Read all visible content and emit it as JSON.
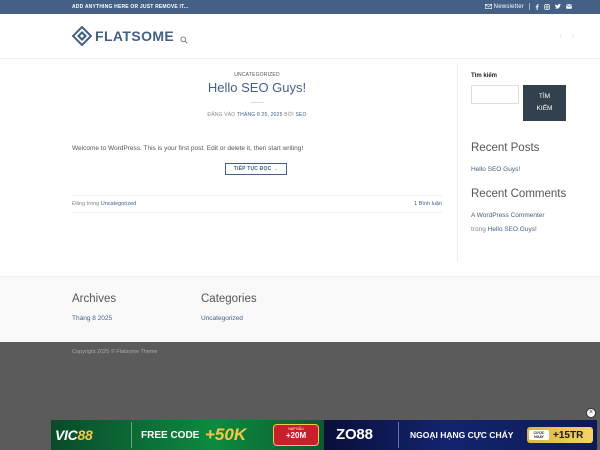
{
  "colors": {
    "primary": "#446084",
    "dark_button": "#33404d",
    "footer_bg": "#5b5b5b"
  },
  "topbar": {
    "promo": "ADD ANYTHING HERE OR JUST REMOVE IT...",
    "newsletter": "Newsletter",
    "icons": [
      "envelope-icon",
      "facebook-icon",
      "instagram-icon",
      "twitter-icon",
      "email-icon"
    ]
  },
  "header": {
    "logo_text": "FLATSOME",
    "nav_prev": "‹",
    "nav_next": "›"
  },
  "post": {
    "category": "UNCATEGORIZED",
    "title": "Hello SEO Guys!",
    "meta_prefix": "ĐĂNG VÀO",
    "meta_date": "THÁNG 8 25, 2025",
    "meta_by": "BỞI",
    "meta_author": "SEO",
    "excerpt": "Welcome to WordPress. This is your first post. Edit or delete it, then start writing!",
    "read_more": "TIẾP TỤC ĐỌC →",
    "footer_prefix": "Đăng trong",
    "footer_category": "Uncategorized",
    "footer_comments": "1 Bình luận"
  },
  "sidebar": {
    "search_label": "Tìm kiếm",
    "search_placeholder": "",
    "search_button_line1": "TÌM",
    "search_button_line2": "KIẾM",
    "recent_posts_title": "Recent Posts",
    "recent_posts": [
      "Hello SEO Guys!"
    ],
    "recent_comments_title": "Recent Comments",
    "comment_author": "A WordPress Commenter",
    "comment_on": "trong",
    "comment_post": "Hello SEO Guys!"
  },
  "footer_widgets": {
    "archives_title": "Archives",
    "archives": [
      "Tháng 8 2025"
    ],
    "categories_title": "Categories",
    "categories": [
      "Uncategorized"
    ]
  },
  "footer": {
    "copyright": "Copyright 2025 © Flatsome Theme"
  },
  "ad": {
    "close": "×",
    "brand1_a": "VIC",
    "brand1_b": "88",
    "free_code": "FREE CODE",
    "bonus": "+50K",
    "badge_small": "NẠP ĐẦU",
    "badge_big": "+20M",
    "brand2": "ZO88",
    "slogan": "NGOẠI HẠNG CỰC CHÁY",
    "cuoc_small": "CƯỢC NGAY",
    "cuoc_big": "+15TR"
  }
}
